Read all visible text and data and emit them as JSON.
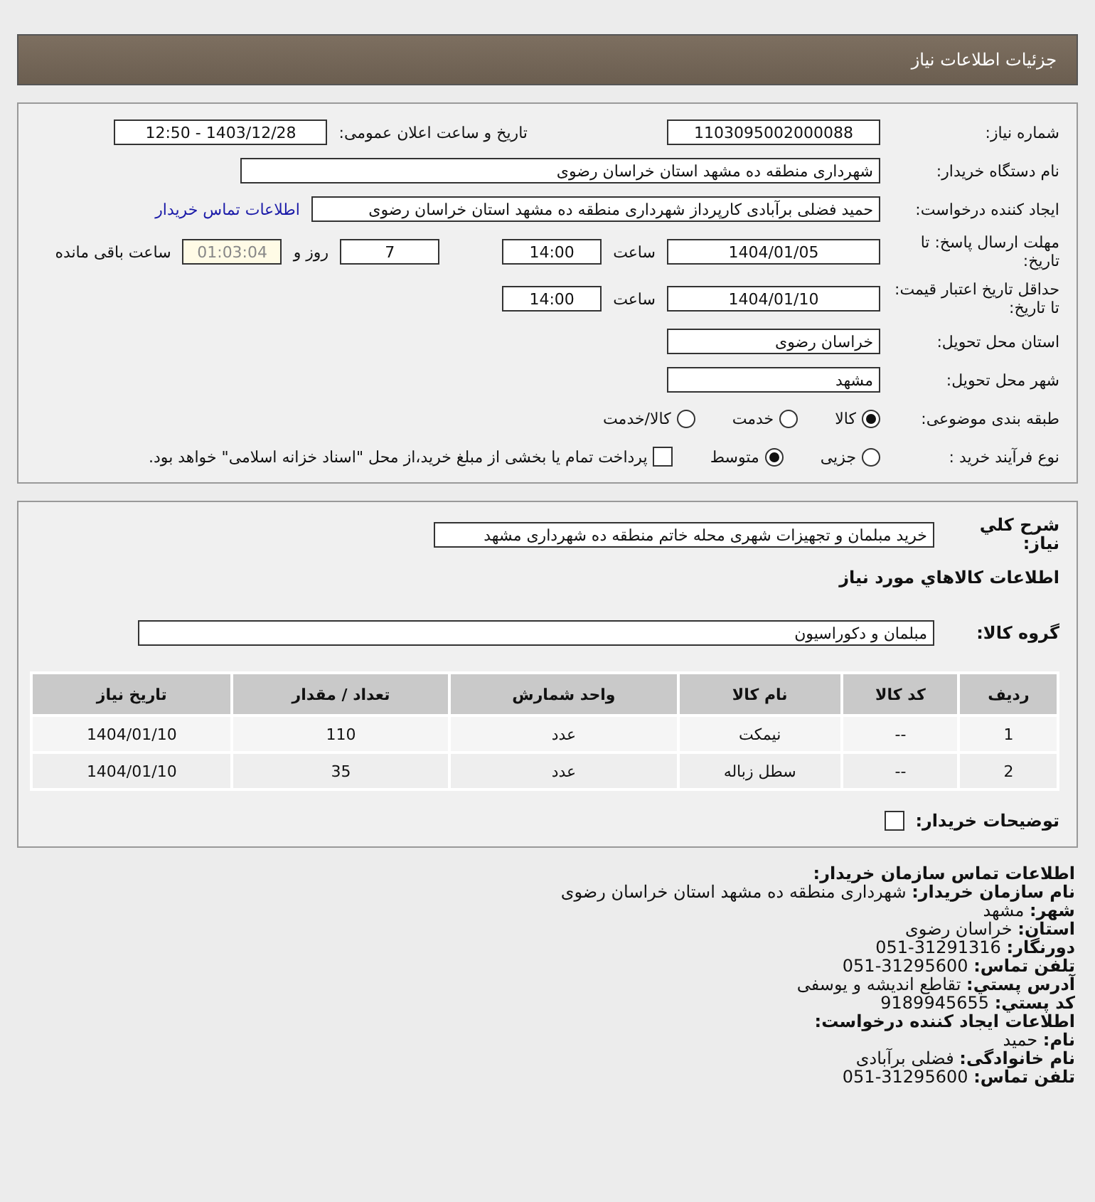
{
  "header": {
    "title": "جزئیات اطلاعات نیاز"
  },
  "need": {
    "number_label": "شماره نیاز:",
    "number": "1103095002000088",
    "announce_label": "تاریخ و ساعت اعلان عمومی:",
    "announce": "1403/12/28 - 12:50",
    "buyer_label": "نام دستگاه خریدار:",
    "buyer": "شهرداری منطقه ده مشهد استان خراسان رضوی",
    "creator_label": "ایجاد کننده درخواست:",
    "creator": "حمید فضلی برآبادی کارپرداز شهرداری منطقه ده مشهد استان خراسان رضوی",
    "contact_link": "اطلاعات تماس خریدار",
    "deadline_label": "مهلت ارسال پاسخ: تا تاریخ:",
    "deadline_date": "1404/01/05",
    "time_label": "ساعت",
    "deadline_time": "14:00",
    "days": "7",
    "days_label": "روز و",
    "remaining": "01:03:04",
    "remaining_label": "ساعت باقی مانده",
    "validity_label": "حداقل تاریخ اعتبار قیمت: تا تاریخ:",
    "validity_date": "1404/01/10",
    "validity_time_label": "ساعت",
    "validity_time": "14:00",
    "province_label": "استان محل تحویل:",
    "province": "خراسان رضوی",
    "city_label": "شهر محل تحویل:",
    "city": "مشهد",
    "category_label": "طبقه بندی موضوعی:",
    "categories": [
      {
        "label": "کالا",
        "selected": true
      },
      {
        "label": "خدمت",
        "selected": false
      },
      {
        "label": "کالا/خدمت",
        "selected": false
      }
    ],
    "process_label": "نوع فرآیند خرید :",
    "processes": [
      {
        "label": "جزیی",
        "selected": false
      },
      {
        "label": "متوسط",
        "selected": true
      }
    ],
    "treasury": {
      "label": "پرداخت تمام یا بخشی از مبلغ خرید،از محل \"اسناد خزانه اسلامی\" خواهد بود.",
      "checked": false
    }
  },
  "goods": {
    "desc_label": "شرح کلي نياز:",
    "desc": "خرید مبلمان و تجهیزات شهری محله خاتم منطقه ده شهرداری مشهد",
    "heading": "اطلاعات کالاهاي مورد نياز",
    "group_label": "گروه کالا:",
    "group": "مبلمان و دکوراسیون",
    "table": {
      "columns": [
        "ردیف",
        "کد کالا",
        "نام کالا",
        "واحد شمارش",
        "تعداد / مقدار",
        "تاریخ نیاز"
      ],
      "rows": [
        [
          "1",
          "--",
          "نیمکت",
          "عدد",
          "110",
          "1404/01/10"
        ],
        [
          "2",
          "--",
          "سطل زباله",
          "عدد",
          "35",
          "1404/01/10"
        ]
      ]
    },
    "notes": {
      "label": "توضیحات خریدار:",
      "checked": false
    }
  },
  "contact": [
    {
      "kind": "heading",
      "text": "اطلاعات تماس سازمان خریدار:"
    },
    {
      "kind": "line",
      "text": "**نام سازمان خریدار:** شهرداری منطقه ده مشهد استان خراسان رضوی"
    },
    {
      "kind": "line",
      "text": "**شهر:** مشهد"
    },
    {
      "kind": "line",
      "text": "**استان:** خراسان رضوی"
    },
    {
      "kind": "line",
      "text": "**دورنگار:** 31291316-051"
    },
    {
      "kind": "line",
      "text": "**تلفن تماس:** 31295600-051"
    },
    {
      "kind": "line",
      "text": "**آدرس پستي:** تقاطع اندیشه و یوسفی"
    },
    {
      "kind": "line",
      "text": "**کد پستي:** 9189945655"
    },
    {
      "kind": "heading",
      "text": "اطلاعات ایجاد کننده درخواست:"
    },
    {
      "kind": "line",
      "text": "**نام:** حمید"
    },
    {
      "kind": "line",
      "text": "**نام خانوادگی:** فضلی برآبادی"
    },
    {
      "kind": "line",
      "text": "**تلفن تماس:** 31295600-051"
    }
  ]
}
